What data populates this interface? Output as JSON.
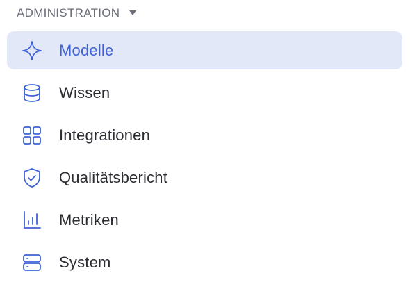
{
  "section": {
    "title": "ADMINISTRATION",
    "caret_icon": "caret-down-icon"
  },
  "nav": {
    "items": [
      {
        "label": "Modelle",
        "icon": "sparkle-icon",
        "active": true
      },
      {
        "label": "Wissen",
        "icon": "database-icon",
        "active": false
      },
      {
        "label": "Integrationen",
        "icon": "grid-icon",
        "active": false
      },
      {
        "label": "Qualitätsbericht",
        "icon": "shield-check-icon",
        "active": false
      },
      {
        "label": "Metriken",
        "icon": "bar-chart-icon",
        "active": false
      },
      {
        "label": "System",
        "icon": "server-icon",
        "active": false
      }
    ]
  },
  "colors": {
    "accent": "#3f63d6",
    "active_bg": "#e3e8f8",
    "text": "#2b2d33",
    "muted": "#6b6e78"
  }
}
